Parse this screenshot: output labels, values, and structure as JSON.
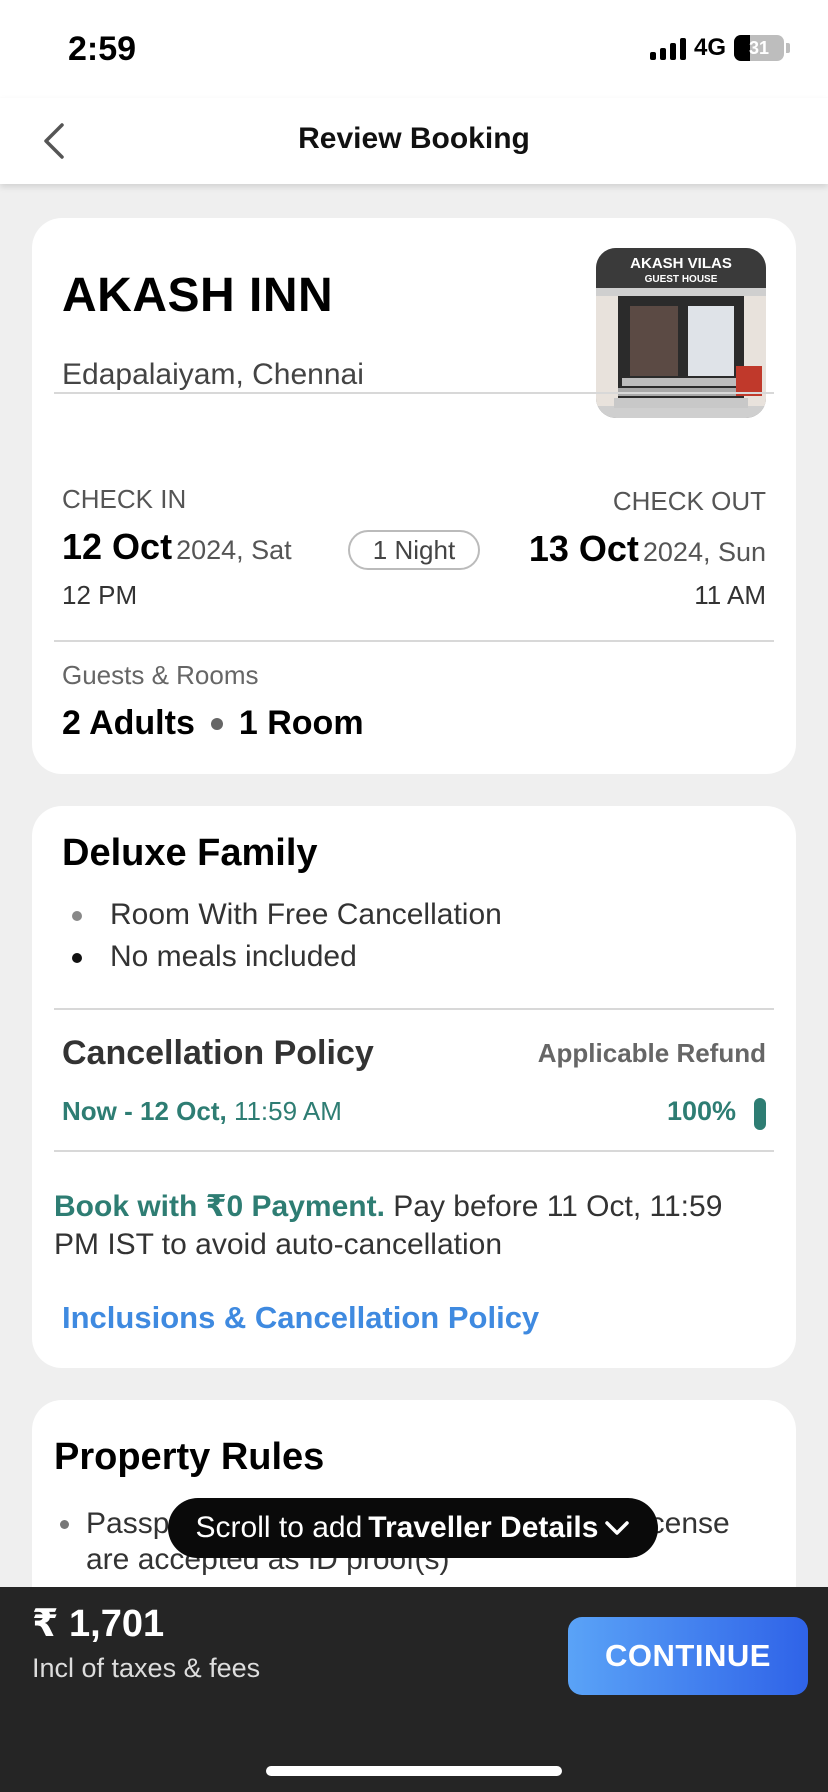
{
  "status_bar": {
    "time": "2:59",
    "network": "4G",
    "battery": "31",
    "battery_level": 0.31
  },
  "header": {
    "title": "Review Booking",
    "back_icon": "chevron-left-icon"
  },
  "hotel": {
    "name": "AKASH INN",
    "location": "Edapalaiyam, Chennai",
    "photo_sign_line1": "AKASH VILAS",
    "photo_sign_line2": "GUEST HOUSE"
  },
  "stay": {
    "check_in_label": "CHECK IN",
    "check_in_date": "12 Oct",
    "check_in_year_day": "2024, Sat",
    "check_in_time": "12 PM",
    "nights": "1 Night",
    "check_out_label": "CHECK OUT",
    "check_out_date": "13 Oct",
    "check_out_year_day": "2024, Sun",
    "check_out_time": "11 AM"
  },
  "guests": {
    "label": "Guests & Rooms",
    "adults": "2 Adults",
    "rooms": "1 Room"
  },
  "room": {
    "name": "Deluxe Family",
    "features": [
      "Room With Free Cancellation",
      "No meals included"
    ]
  },
  "cancellation": {
    "title": "Cancellation Policy",
    "refund_label": "Applicable Refund",
    "period_bold": "Now - 12 Oct,",
    "period_time": "11:59 AM",
    "refund": "100%",
    "pay_highlight": "Book with ₹0 Payment.",
    "pay_text": "Pay before 11 Oct, 11:59 PM IST to avoid auto-cancellation",
    "link": "Inclusions & Cancellation Policy"
  },
  "property_rules": {
    "title": "Property Rules",
    "item": "Passport, Aadhaar, Govt. ID and Driving License are accepted as ID proof(s)"
  },
  "toast": {
    "prefix": "Scroll to add",
    "bold": "Traveller Details"
  },
  "footer": {
    "price": "₹ 1,701",
    "price_note": "Incl of taxes & fees",
    "continue_label": "CONTINUE"
  },
  "colors": {
    "accent_green": "#2e7d73",
    "link_blue": "#3f8ae0",
    "button_gradient_start": "#5aa3f7",
    "button_gradient_end": "#2f63e8",
    "footer_bg": "#252525"
  }
}
